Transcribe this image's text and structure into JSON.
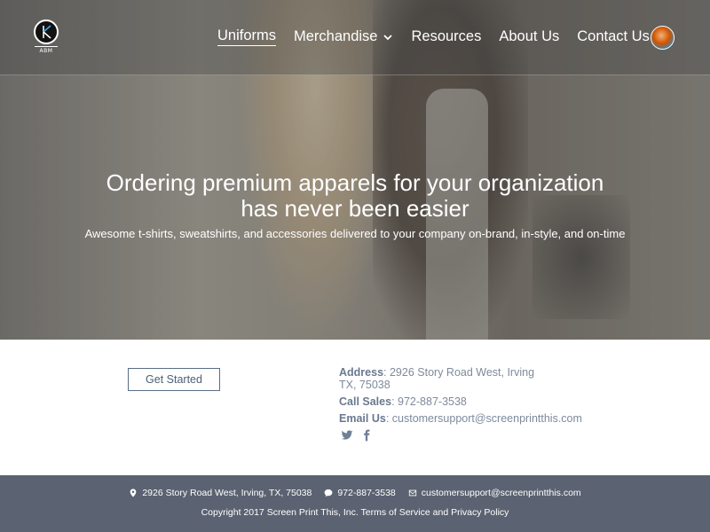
{
  "header": {
    "logo_text": "ABM",
    "nav": [
      {
        "label": "Uniforms"
      },
      {
        "label": "Merchandise"
      },
      {
        "label": "Resources"
      },
      {
        "label": "About Us"
      },
      {
        "label": "Contact Us"
      }
    ]
  },
  "hero": {
    "title_line1": "Ordering premium apparels for your organization",
    "title_line2": "has never been easier",
    "subtitle": "Awesome t-shirts, sweatshirts, and accessories delivered to your company on-brand, in-style, and on-time"
  },
  "cta": {
    "label": "Get Started"
  },
  "contact": {
    "address_label": "Address",
    "address_line1": "2926 Story Road West, Irving",
    "address_line2": "TX, 75038",
    "sales_label": "Call Sales",
    "sales_value": "972-887-3538",
    "email_label": "Email Us",
    "email_value": "customersupport@screenprintthis.com"
  },
  "footer": {
    "address": "2926 Story Road West, Irving, TX, 75038",
    "phone": "972-887-3538",
    "email": "customersupport@screenprintthis.com",
    "copyright": "Copyright 2017 Screen Print This, Inc.",
    "terms": "Terms of Service and Privacy Policy"
  }
}
